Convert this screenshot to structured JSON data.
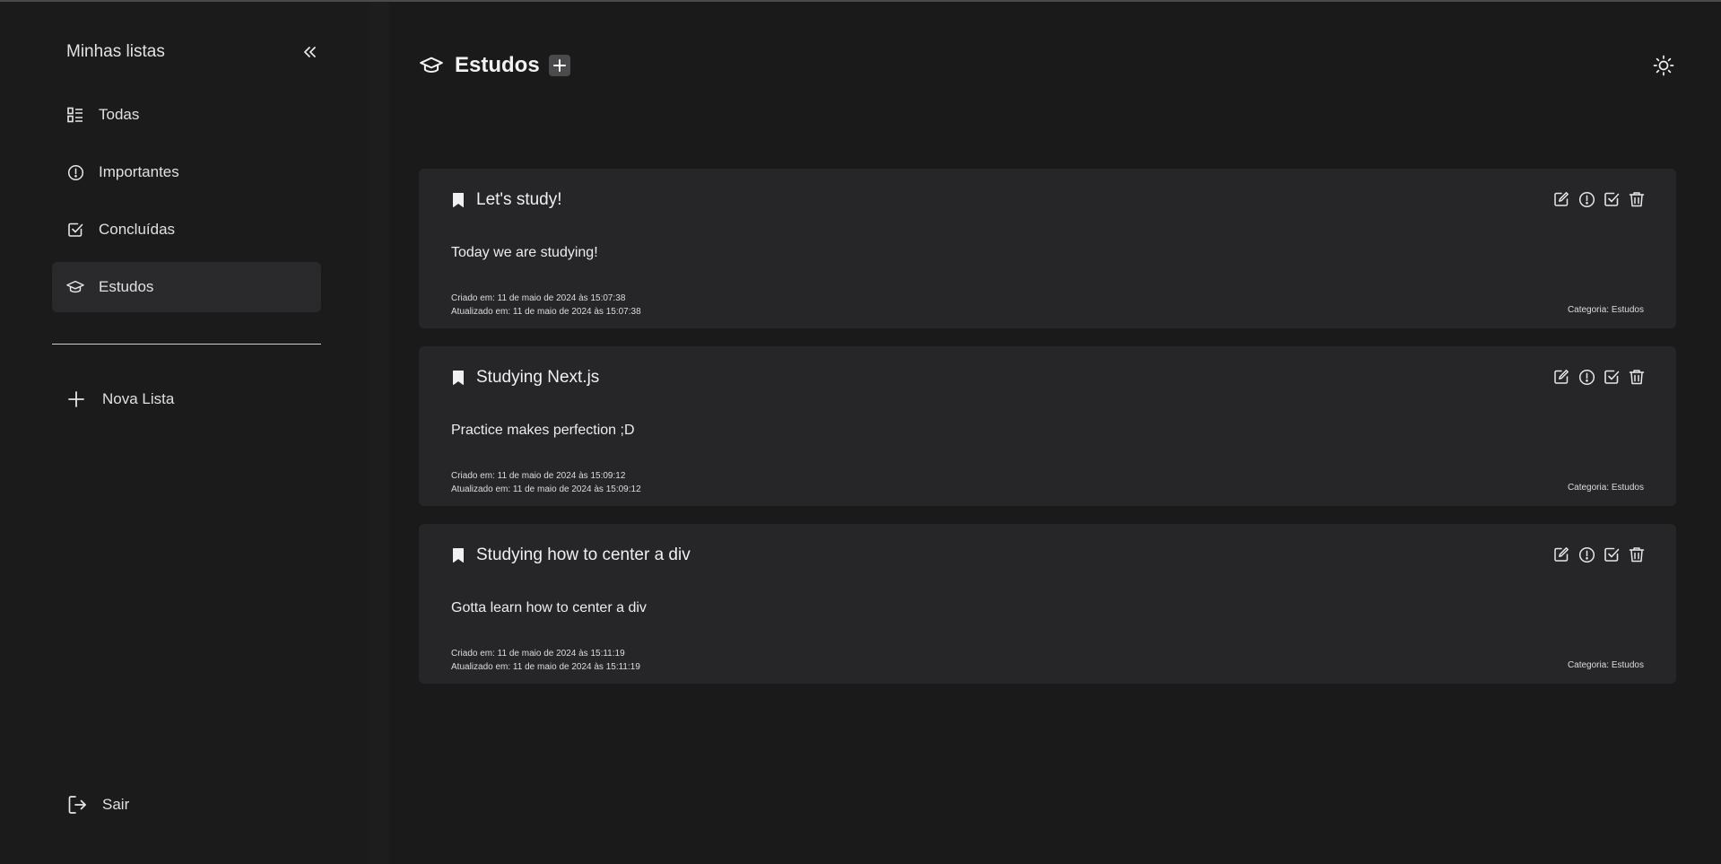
{
  "sidebar": {
    "title": "Minhas listas",
    "items": [
      {
        "label": "Todas",
        "icon": "list-grid-icon"
      },
      {
        "label": "Importantes",
        "icon": "alert-circle-icon"
      },
      {
        "label": "Concluídas",
        "icon": "check-square-icon"
      },
      {
        "label": "Estudos",
        "icon": "graduation-cap-icon",
        "active": true
      }
    ],
    "new_list_label": "Nova Lista",
    "logout_label": "Sair"
  },
  "header": {
    "title": "Estudos"
  },
  "tasks": [
    {
      "title": "Let's study!",
      "description": "Today we are studying!",
      "created": "Criado em: 11 de maio de 2024 às 15:07:38",
      "updated": "Atualizado em: 11 de maio de 2024 às 15:07:38",
      "category": "Categoria: Estudos"
    },
    {
      "title": "Studying Next.js",
      "description": "Practice makes perfection ;D",
      "created": "Criado em: 11 de maio de 2024 às 15:09:12",
      "updated": "Atualizado em: 11 de maio de 2024 às 15:09:12",
      "category": "Categoria: Estudos"
    },
    {
      "title": "Studying how to center a div",
      "description": "Gotta learn how to center a div",
      "created": "Criado em: 11 de maio de 2024 às 15:11:19",
      "updated": "Atualizado em: 11 de maio de 2024 às 15:11:19",
      "category": "Categoria: Estudos"
    }
  ],
  "colors": {
    "background": "#1a1a1a",
    "sidebar": "#1b1b1c",
    "card": "#262628",
    "active_item": "#2a2a2c",
    "text": "#e6e6e6"
  }
}
